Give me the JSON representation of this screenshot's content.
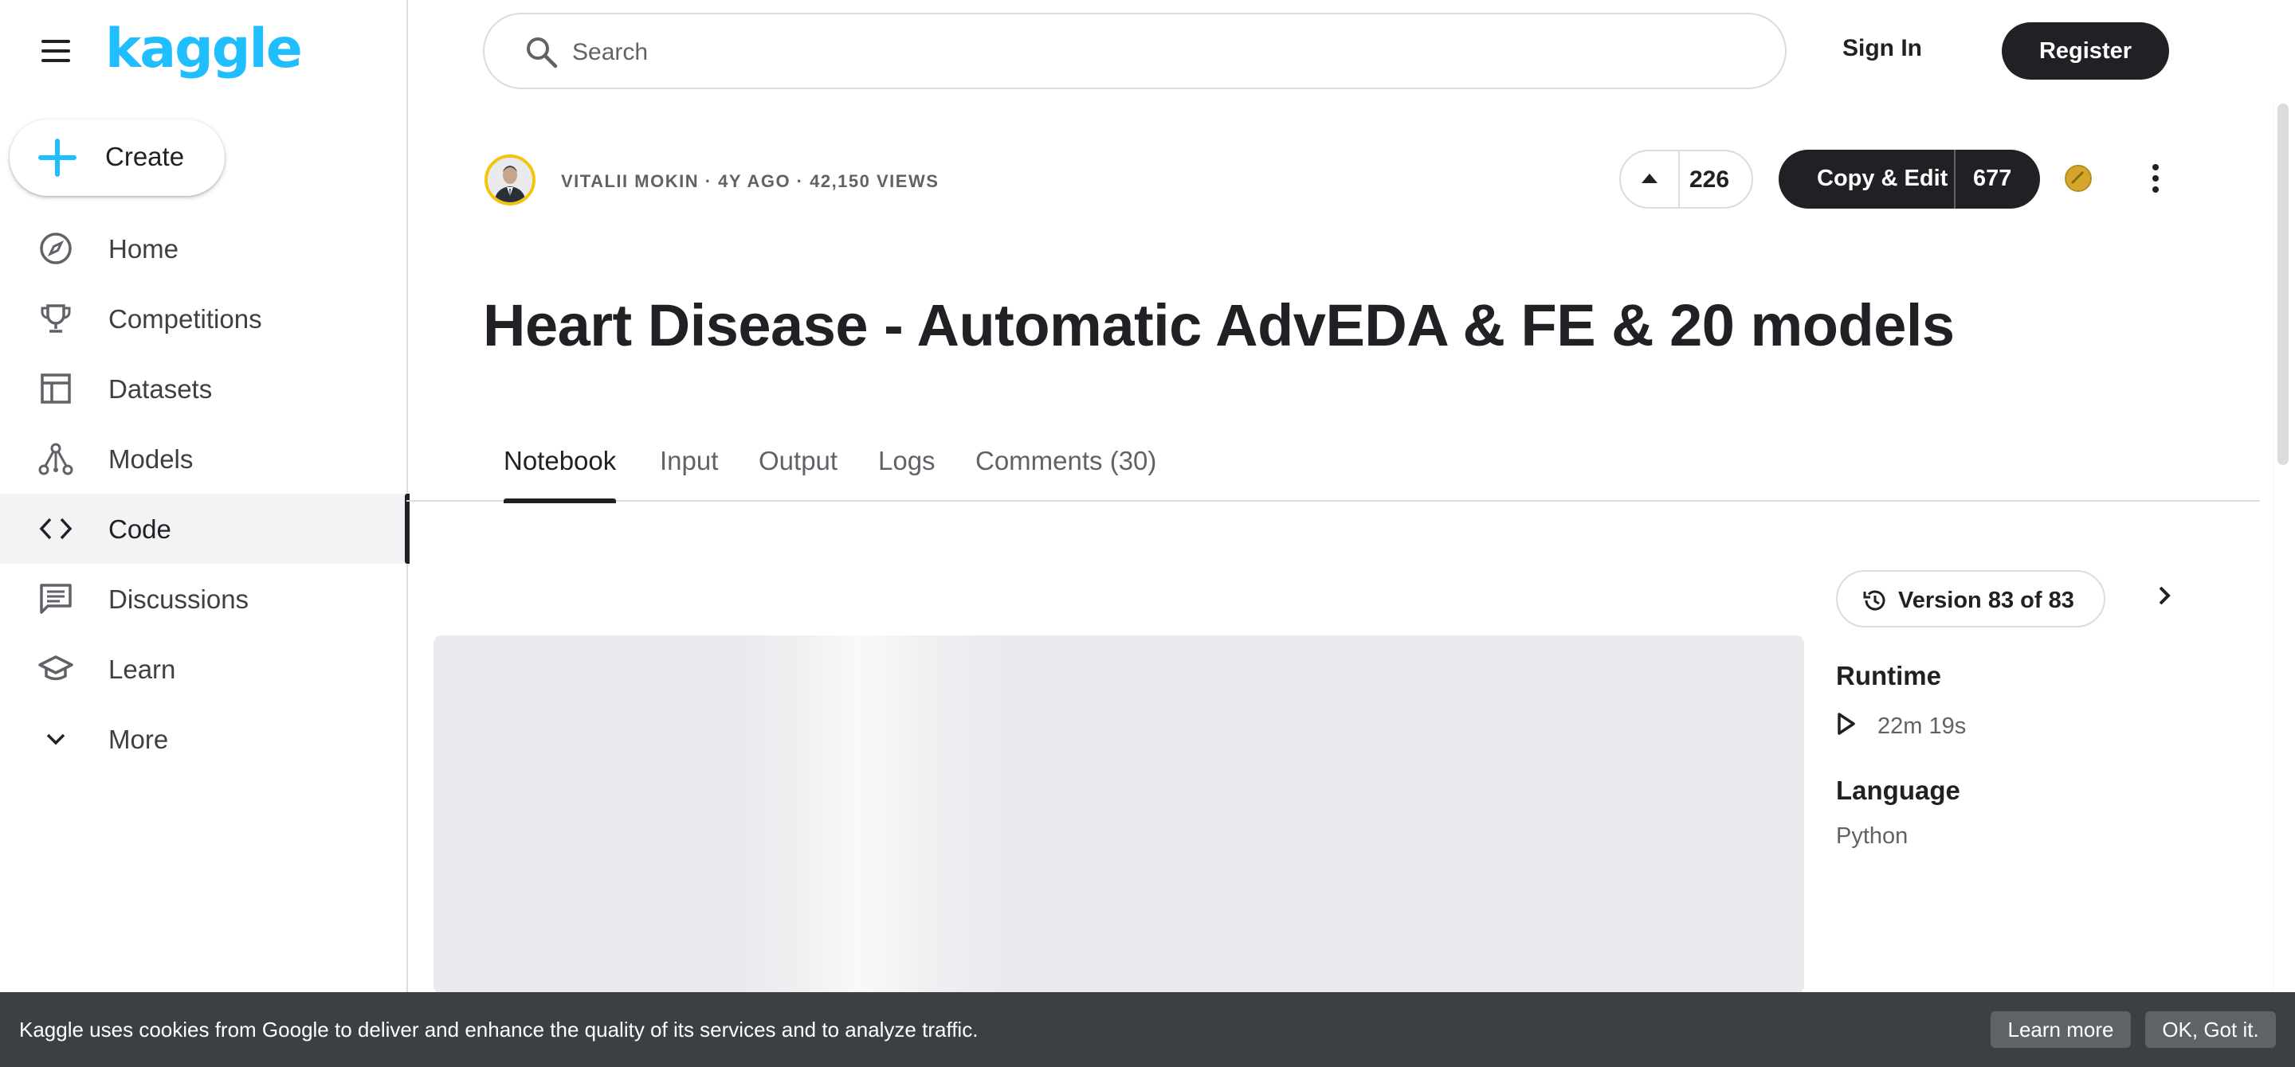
{
  "brand": {
    "logo_text": "kaggle",
    "color": "#20beff"
  },
  "sidebar": {
    "create_label": "Create",
    "items": [
      {
        "label": "Home",
        "icon": "compass-icon"
      },
      {
        "label": "Competitions",
        "icon": "trophy-icon"
      },
      {
        "label": "Datasets",
        "icon": "table-icon"
      },
      {
        "label": "Models",
        "icon": "models-icon"
      },
      {
        "label": "Code",
        "icon": "code-icon",
        "active": true
      },
      {
        "label": "Discussions",
        "icon": "discussion-icon"
      },
      {
        "label": "Learn",
        "icon": "graduation-cap-icon"
      },
      {
        "label": "More",
        "icon": "chevron-down-icon"
      }
    ]
  },
  "header": {
    "search_placeholder": "Search",
    "sign_in": "Sign In",
    "register": "Register"
  },
  "notebook": {
    "meta": "VITALII MOKIN · 4Y AGO · 42,150 VIEWS",
    "upvotes": "226",
    "copy_edit_label": "Copy & Edit",
    "copy_edit_count": "677",
    "medal_color": "#d4a72c",
    "title": "Heart Disease - Automatic AdvEDA & FE & 20 models"
  },
  "tabs": [
    {
      "label": "Notebook",
      "active": true
    },
    {
      "label": "Input"
    },
    {
      "label": "Output"
    },
    {
      "label": "Logs"
    },
    {
      "label": "Comments (30)"
    }
  ],
  "details": {
    "version": "Version 83 of 83",
    "runtime_heading": "Runtime",
    "runtime_value": "22m 19s",
    "language_heading": "Language",
    "language_value": "Python"
  },
  "cookie": {
    "text": "Kaggle uses cookies from Google to deliver and enhance the quality of its services and to analyze traffic.",
    "learn_more": "Learn more",
    "ok": "OK, Got it."
  }
}
